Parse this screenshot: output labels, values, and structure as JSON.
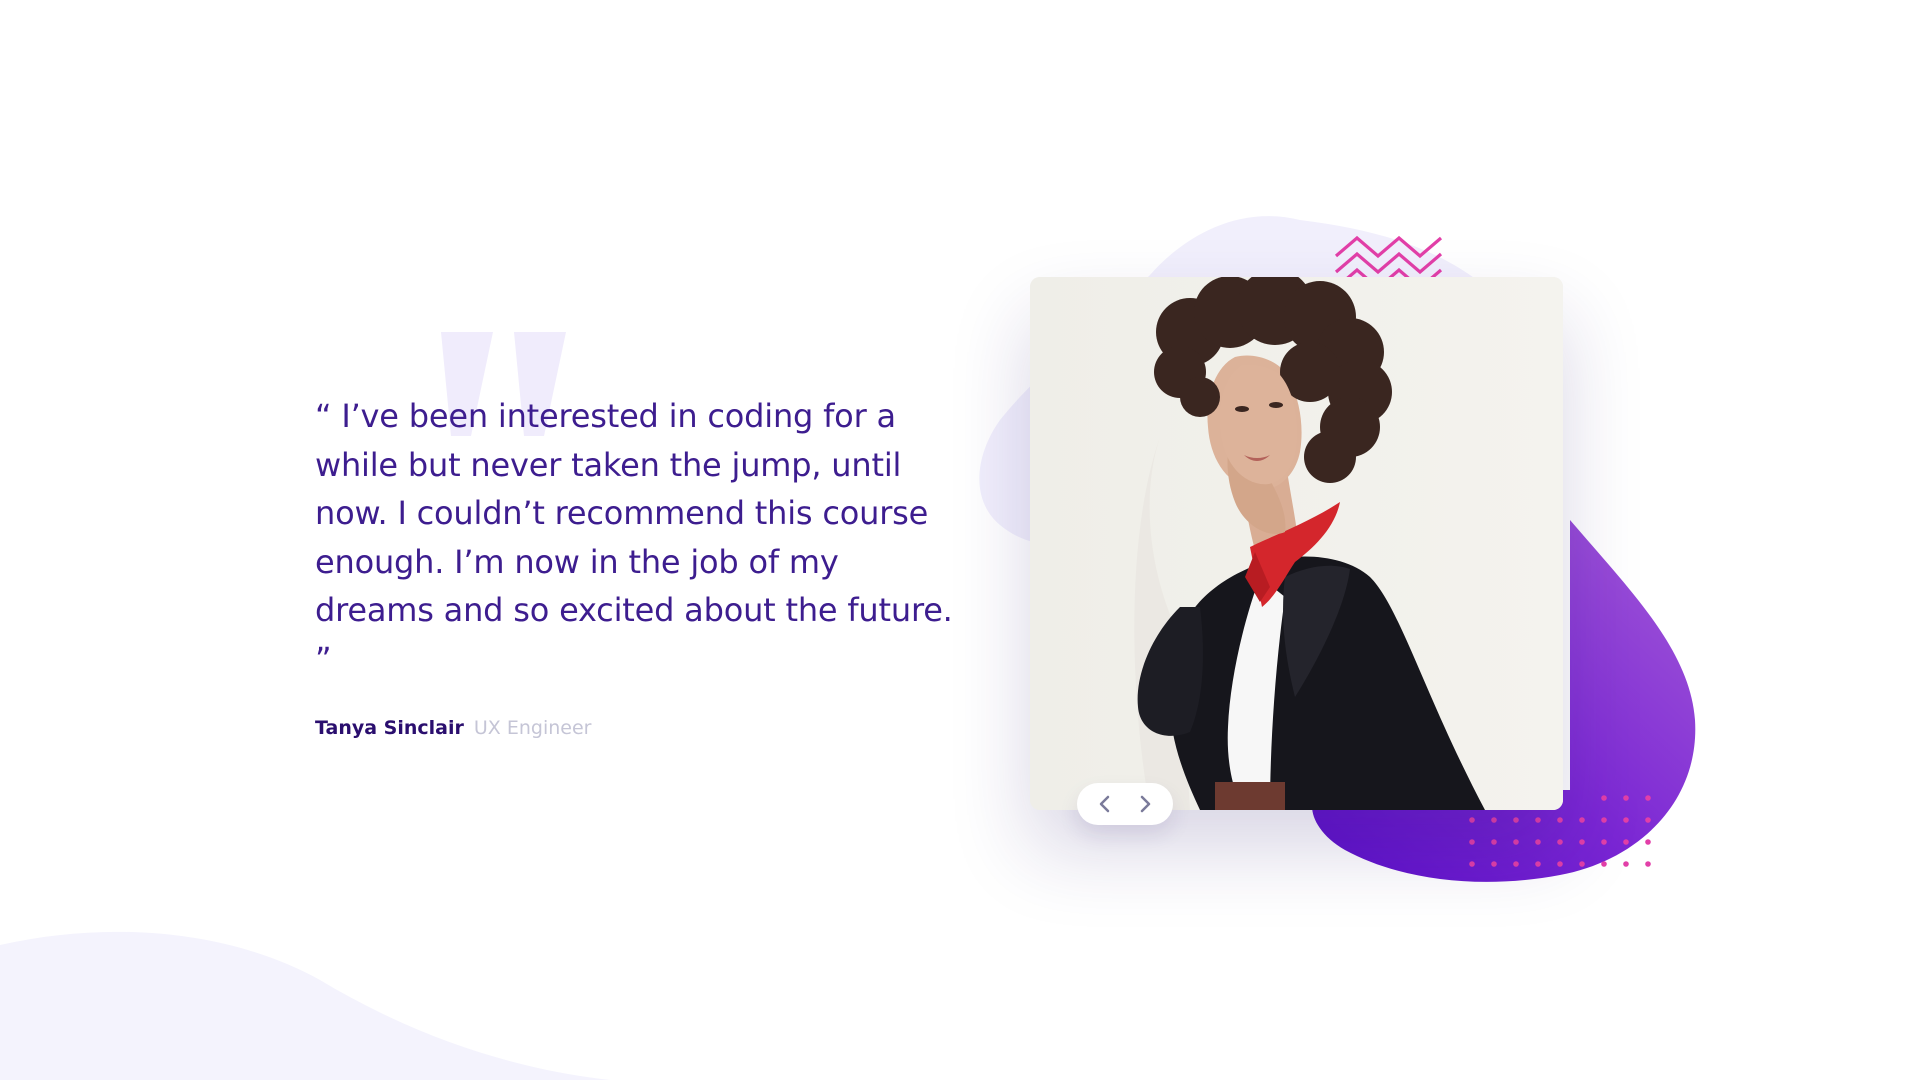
{
  "testimonial": {
    "quote": "“ I’ve been interested in coding for a while but never taken the jump, until now. I couldn’t recommend this course enough. I’m now in the job of my dreams and so excited about the future. ”",
    "author_name": "Tanya Sinclair",
    "author_role": "UX Engineer"
  },
  "slider": {
    "prev_icon": "chevron-left-icon",
    "next_icon": "chevron-right-icon"
  },
  "colors": {
    "quote_text": "#3d1d8f",
    "author_name": "#2a0e6e",
    "author_role": "#c5c5d6",
    "accent_purple": "#6c21d6",
    "accent_pink": "#e23fa8",
    "soft_lavender": "#f1effc"
  }
}
